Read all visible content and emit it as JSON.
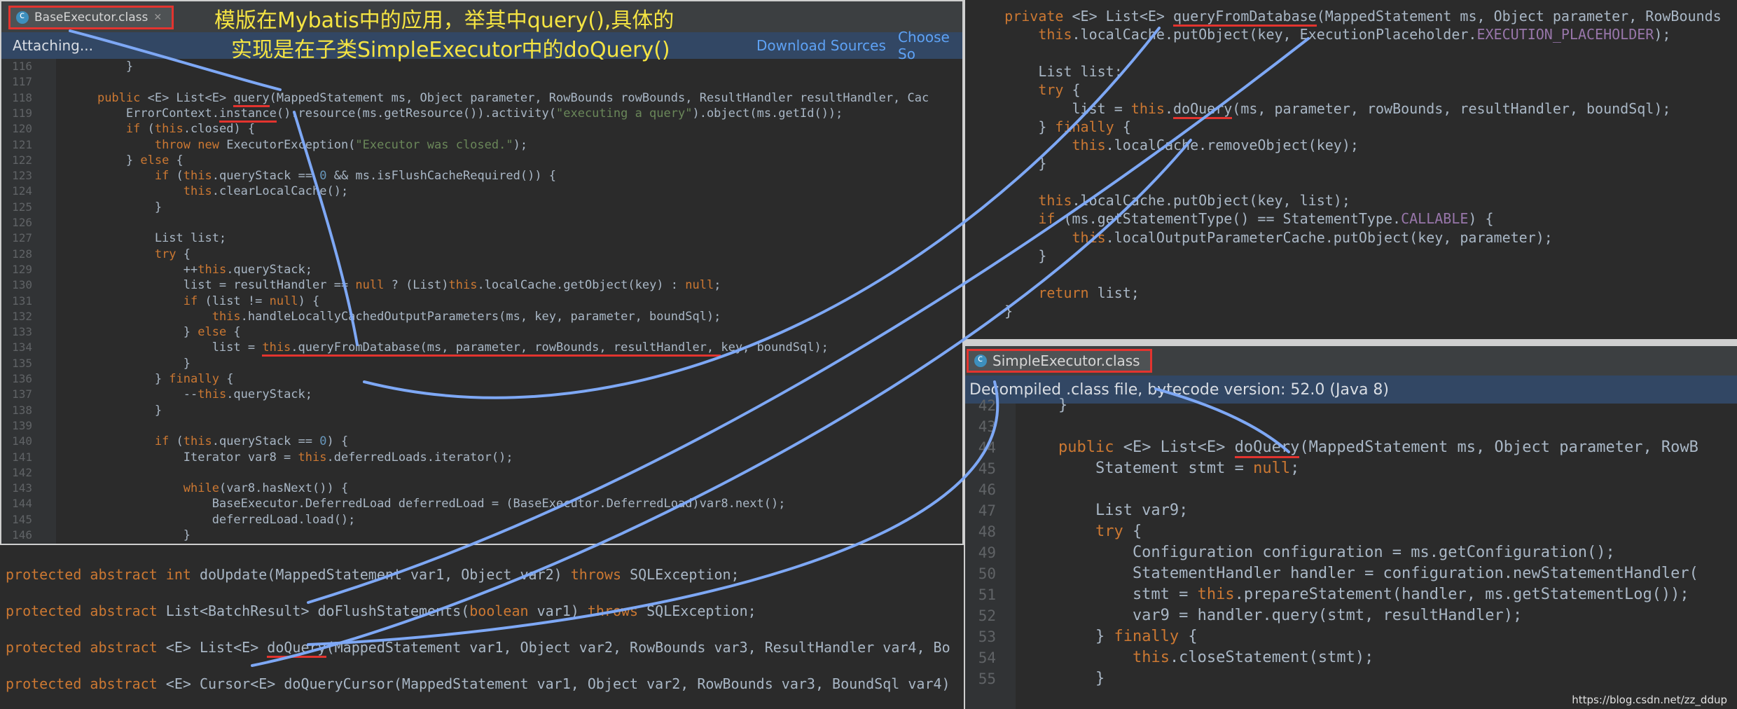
{
  "base_panel": {
    "tab_label": "BaseExecutor.class",
    "info_text": "Attaching...",
    "download_sources": "Download Sources",
    "choose_sources": "Choose So",
    "lines": [
      {
        "n": "116",
        "html": "        <span class=\"plain\">}</span>"
      },
      {
        "n": "117",
        "html": ""
      },
      {
        "n": "118",
        "html": "    <span class=\"kw\">public </span>&lt;E&gt; List&lt;E&gt; <span class=\"ul\">query</span>(MappedStatement ms, Object parameter, RowBounds rowBounds, ResultHandler resultHandler, Cac"
      },
      {
        "n": "119",
        "html": "        ErrorContext.<span class=\"ul\">instance</span>().resource(ms.getResource()).activity(<span class=\"str\">\"executing a query\"</span>).object(ms.getId());"
      },
      {
        "n": "120",
        "html": "        <span class=\"kw\">if </span>(<span class=\"kw\">this</span>.closed) {"
      },
      {
        "n": "121",
        "html": "            <span class=\"kw\">throw new </span>ExecutorException(<span class=\"str\">\"Executor was closed.\"</span>);"
      },
      {
        "n": "122",
        "html": "        } <span class=\"kw\">else </span>{"
      },
      {
        "n": "123",
        "html": "            <span class=\"kw\">if </span>(<span class=\"kw\">this</span>.queryStack == <span class=\"num\">0</span> &amp;&amp; ms.isFlushCacheRequired()) {"
      },
      {
        "n": "124",
        "html": "                <span class=\"kw\">this</span>.clearLocalCache();"
      },
      {
        "n": "125",
        "html": "            }"
      },
      {
        "n": "126",
        "html": ""
      },
      {
        "n": "127",
        "html": "            List list;"
      },
      {
        "n": "128",
        "html": "            <span class=\"kw\">try </span>{"
      },
      {
        "n": "129",
        "html": "                ++<span class=\"kw\">this</span>.queryStack;"
      },
      {
        "n": "130",
        "html": "                list = resultHandler == <span class=\"kw\">null </span>? (List)<span class=\"kw\">this</span>.localCache.getObject(key) : <span class=\"kw\">null</span>;"
      },
      {
        "n": "131",
        "html": "                <span class=\"kw\">if </span>(list != <span class=\"kw\">null</span>) {"
      },
      {
        "n": "132",
        "html": "                    <span class=\"kw\">this</span>.handleLocallyCachedOutputParameters(ms, key, parameter, boundSql);"
      },
      {
        "n": "133",
        "html": "                } <span class=\"kw\">else </span>{"
      },
      {
        "n": "134",
        "html": "                    list = <span class=\"ul\"><span class=\"kw\">this</span>.queryFromDatabase(ms, parameter, rowBounds, resultHandler, </span>key, boundSql);"
      },
      {
        "n": "135",
        "html": "                }"
      },
      {
        "n": "136",
        "html": "            } <span class=\"kw\">finally </span>{"
      },
      {
        "n": "137",
        "html": "                --<span class=\"kw\">this</span>.queryStack;"
      },
      {
        "n": "138",
        "html": "            }"
      },
      {
        "n": "139",
        "html": ""
      },
      {
        "n": "140",
        "html": "            <span class=\"kw\">if </span>(<span class=\"kw\">this</span>.queryStack == <span class=\"num\">0</span>) {"
      },
      {
        "n": "141",
        "html": "                Iterator var8 = <span class=\"kw\">this</span>.deferredLoads.iterator();"
      },
      {
        "n": "142",
        "html": ""
      },
      {
        "n": "143",
        "html": "                <span class=\"kw\">while</span>(var8.hasNext()) {"
      },
      {
        "n": "144",
        "html": "                    BaseExecutor.DeferredLoad deferredLoad = (BaseExecutor.DeferredLoad)var8.next();"
      },
      {
        "n": "145",
        "html": "                    deferredLoad.load();"
      },
      {
        "n": "146",
        "html": "                }"
      }
    ]
  },
  "abstract_panel": {
    "lines": [
      "<span class=\"kw\">protected abstract int </span>doUpdate(MappedStatement var1, Object var2) <span class=\"kw\">throws </span>SQLException;",
      "<span class=\"kw\">protected abstract </span>List&lt;BatchResult&gt; doFlushStatements(<span class=\"kw\">boolean </span>var1) <span class=\"kw\">throws </span>SQLException;",
      "<span class=\"kw\">protected abstract </span>&lt;E&gt; List&lt;E&gt; <span class=\"ul\">doQuery</span>(MappedStatement var1, Object var2, RowBounds var3, ResultHandler var4, Bo",
      "<span class=\"kw\">protected abstract </span>&lt;E&gt; Cursor&lt;E&gt; doQueryCursor(MappedStatement var1, Object var2, RowBounds var3, BoundSql var4)"
    ]
  },
  "qfd_panel": {
    "lines": [
      "    <span class=\"kw\">private </span>&lt;E&gt; List&lt;E&gt; <span class=\"ul\">queryFromDatabase</span>(MappedStatement ms, Object parameter, RowBounds",
      "        <span class=\"kw\">this</span>.localCache.putObject(key, ExecutionPlaceholder.<span class=\"fld\">EXECUTION_PLACEHOLDER</span>);",
      "",
      "        List list;",
      "        <span class=\"kw\">try </span>{",
      "            list = <span class=\"kw\">this</span>.<span class=\"ul\">doQuery</span>(ms, parameter, rowBounds, resultHandler, boundSql);",
      "        } <span class=\"kw\">finally </span>{",
      "            <span class=\"kw\">this</span>.localCache.removeObject(key);",
      "        }",
      "",
      "        <span class=\"kw\">this</span>.localCache.putObject(key, list);",
      "        <span class=\"kw\">if </span>(ms.getStatementType() == StatementType.<span class=\"fld\">CALLABLE</span>) {",
      "            <span class=\"kw\">this</span>.localOutputParameterCache.putObject(key, parameter);",
      "        }",
      "",
      "        <span class=\"kw\">return </span>list;",
      "    }"
    ]
  },
  "simple_panel": {
    "tab_label": "SimpleExecutor.class",
    "info_text": "Decompiled .class file, bytecode version: 52.0 (Java 8)",
    "lines": [
      {
        "n": "42",
        "html": "    }"
      },
      {
        "n": "43",
        "html": ""
      },
      {
        "n": "44",
        "html": "    <span class=\"kw\">public </span>&lt;E&gt; List&lt;E&gt; <span class=\"ul\">doQuery</span>(MappedStatement ms, Object parameter, RowB"
      },
      {
        "n": "45",
        "html": "        Statement stmt = <span class=\"kw\">null</span>;"
      },
      {
        "n": "46",
        "html": ""
      },
      {
        "n": "47",
        "html": "        List var9;"
      },
      {
        "n": "48",
        "html": "        <span class=\"kw\">try </span>{"
      },
      {
        "n": "49",
        "html": "            Configuration configuration = ms.getConfiguration();"
      },
      {
        "n": "50",
        "html": "            StatementHandler handler = configuration.newStatementHandler("
      },
      {
        "n": "51",
        "html": "            stmt = <span class=\"kw\">this</span>.prepareStatement(handler, ms.getStatementLog());"
      },
      {
        "n": "52",
        "html": "            var9 = handler.query(stmt, resultHandler);"
      },
      {
        "n": "53",
        "html": "        } <span class=\"kw\">finally </span>{"
      },
      {
        "n": "54",
        "html": "            <span class=\"kw\">this</span>.closeStatement(stmt);"
      },
      {
        "n": "55",
        "html": "        }"
      }
    ]
  },
  "annotation": {
    "line1": "模版在Mybatis中的应用，举其中query(),具体的",
    "line2": "实现是在子类SimpleExecutor中的doQuery()"
  },
  "watermark": "https://blog.csdn.net/zz_ddup"
}
